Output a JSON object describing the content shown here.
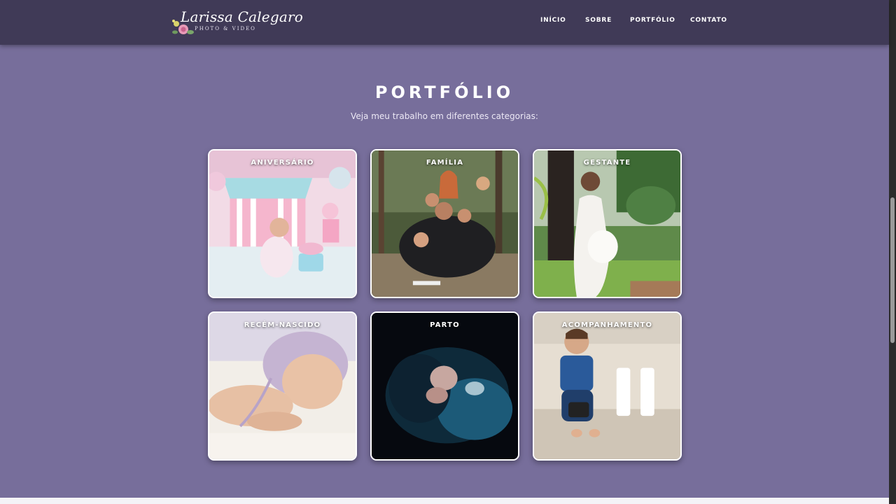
{
  "brand": {
    "name": "Larissa Calegaro",
    "tagline": "PHOTO & VIDEO"
  },
  "nav": {
    "items": [
      {
        "label": "INÍCIO"
      },
      {
        "label": "SOBRE"
      },
      {
        "label": "PORTFÓLIO"
      },
      {
        "label": "CONTATO"
      }
    ]
  },
  "portfolio": {
    "title": "PORTFÓLIO",
    "subtitle": "Veja meu trabalho em diferentes categorias:",
    "categories": [
      {
        "label": "ANIVERSÁRIO"
      },
      {
        "label": "FAMÍLIA"
      },
      {
        "label": "GESTANTE"
      },
      {
        "label": "RECÉM-NASCIDO"
      },
      {
        "label": "PARTO"
      },
      {
        "label": "ACOMPANHAMENTO"
      }
    ]
  },
  "colors": {
    "header_bg": "#403a57",
    "page_bg": "#776e9b",
    "card_border": "#ffffff"
  }
}
